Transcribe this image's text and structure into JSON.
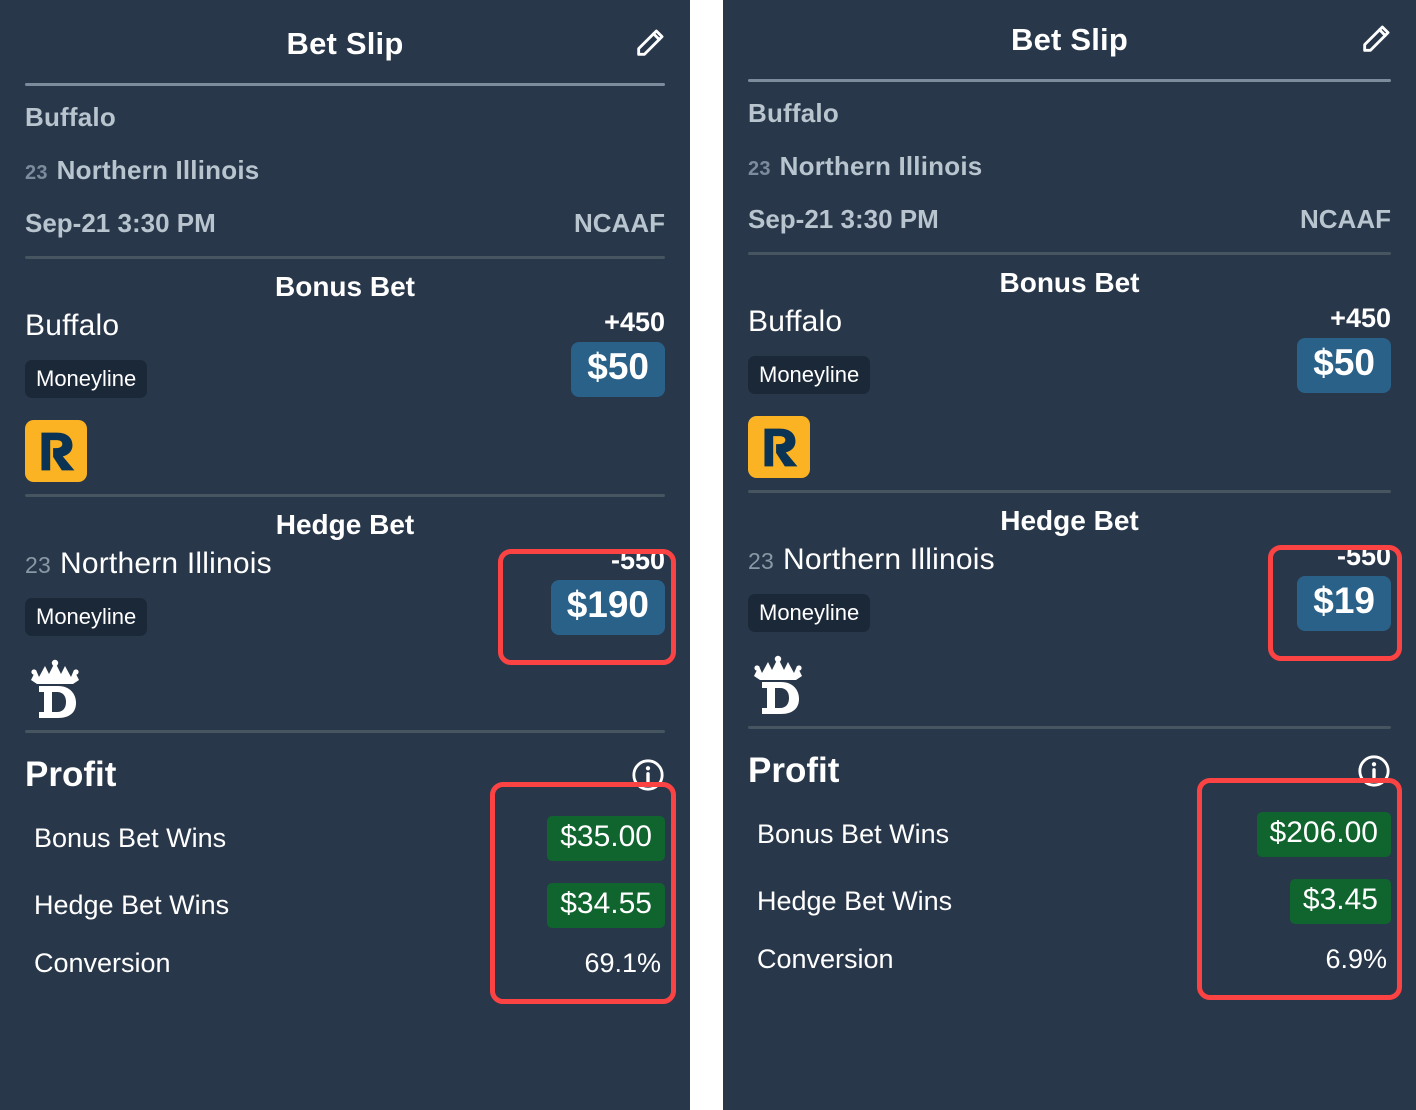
{
  "colors": {
    "panel_bg": "#28374a",
    "chip_blue": "#2a6189",
    "chip_green": "#10642e",
    "highlight_red": "#fc4343",
    "rebet_yellow": "#fbb323",
    "rebet_navy": "#0b3354",
    "text_white": "#ffffff",
    "text_muted": "#b8c4ce"
  },
  "panels": [
    {
      "id": "left",
      "header": {
        "title": "Bet Slip",
        "edit_icon": "pencil-icon"
      },
      "matchup": {
        "away_team": "Buffalo",
        "home_rank": "23",
        "home_team": "Northern Illinois",
        "datetime": "Sep-21 3:30 PM",
        "league": "NCAAF"
      },
      "bonus_bet": {
        "title": "Bonus Bet",
        "selection": "Buffalo",
        "rank": "",
        "market": "Moneyline",
        "odds": "+450",
        "stake": "$50",
        "book": "rebet-logo",
        "highlighted": false
      },
      "hedge_bet": {
        "title": "Hedge Bet",
        "selection": "Northern Illinois",
        "rank": "23",
        "market": "Moneyline",
        "odds": "-550",
        "stake": "$190",
        "book": "draftkings-logo",
        "highlighted": true
      },
      "profit": {
        "title": "Profit",
        "info_icon": "info-icon",
        "highlighted": true,
        "rows": [
          {
            "label": "Bonus Bet Wins",
            "value": "$35.00",
            "style": "green-chip"
          },
          {
            "label": "Hedge Bet Wins",
            "value": "$34.55",
            "style": "green-chip"
          },
          {
            "label": "Conversion",
            "value": "69.1%",
            "style": "plain"
          }
        ]
      }
    },
    {
      "id": "right",
      "header": {
        "title": "Bet Slip",
        "edit_icon": "pencil-icon"
      },
      "matchup": {
        "away_team": "Buffalo",
        "home_rank": "23",
        "home_team": "Northern Illinois",
        "datetime": "Sep-21 3:30 PM",
        "league": "NCAAF"
      },
      "bonus_bet": {
        "title": "Bonus Bet",
        "selection": "Buffalo",
        "rank": "",
        "market": "Moneyline",
        "odds": "+450",
        "stake": "$50",
        "book": "rebet-logo",
        "highlighted": false
      },
      "hedge_bet": {
        "title": "Hedge Bet",
        "selection": "Northern Illinois",
        "rank": "23",
        "market": "Moneyline",
        "odds": "-550",
        "stake": "$19",
        "book": "draftkings-logo",
        "highlighted": true
      },
      "profit": {
        "title": "Profit",
        "info_icon": "info-icon",
        "highlighted": true,
        "rows": [
          {
            "label": "Bonus Bet Wins",
            "value": "$206.00",
            "style": "green-chip"
          },
          {
            "label": "Hedge Bet Wins",
            "value": "$3.45",
            "style": "green-chip"
          },
          {
            "label": "Conversion",
            "value": "6.9%",
            "style": "plain"
          }
        ]
      }
    }
  ]
}
